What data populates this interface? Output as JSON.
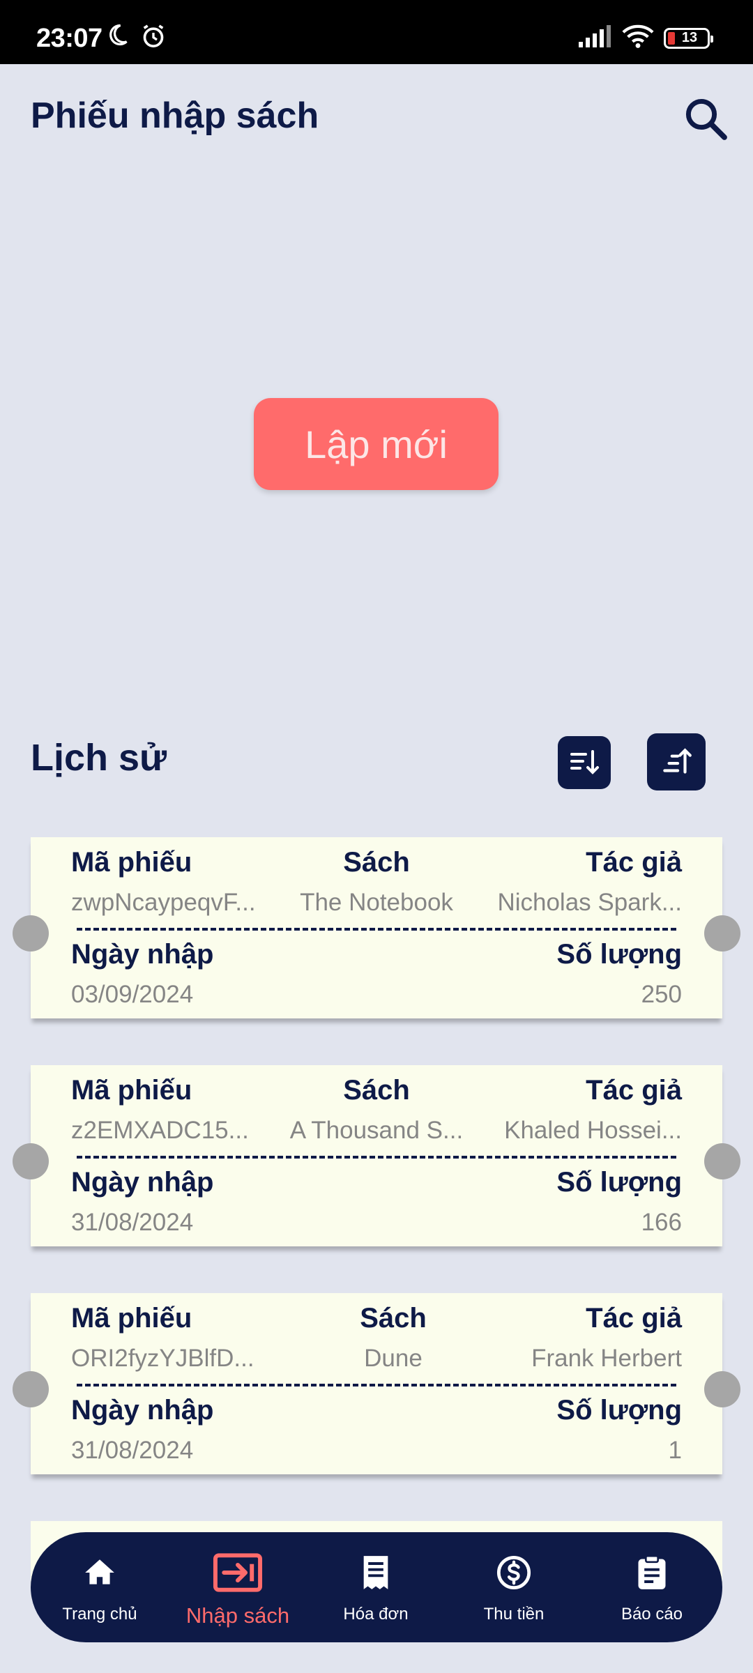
{
  "status_bar": {
    "time": "23:07",
    "battery": "13",
    "icons": [
      "moon-icon",
      "alarm-icon",
      "signal-icon",
      "wifi-icon",
      "battery-icon"
    ]
  },
  "header": {
    "title": "Phiếu nhập sách",
    "search_icon": "search-icon"
  },
  "main": {
    "new_button_label": "Lập mới",
    "history_title": "Lịch sử",
    "sort_desc_icon": "sort-descending-icon",
    "sort_asc_icon": "sort-ascending-icon"
  },
  "labels": {
    "receipt_code": "Mã phiếu",
    "book": "Sách",
    "author": "Tác giả",
    "import_date": "Ngày nhập",
    "quantity": "Số lượng"
  },
  "receipts": [
    {
      "code": "zwpNcaypeqvF...",
      "book": "The Notebook",
      "author": "Nicholas Spark...",
      "date": "03/09/2024",
      "quantity": "250"
    },
    {
      "code": "z2EMXADC15...",
      "book": "A Thousand S...",
      "author": "Khaled Hossei...",
      "date": "31/08/2024",
      "quantity": "166"
    },
    {
      "code": "ORI2fyzYJBlfD...",
      "book": "Dune",
      "author": "Frank Herbert",
      "date": "31/08/2024",
      "quantity": "1"
    }
  ],
  "bottom_nav": {
    "items": [
      {
        "label": "Trang chủ",
        "icon": "home-icon"
      },
      {
        "label": "Nhập sách",
        "icon": "import-icon"
      },
      {
        "label": "Hóa đơn",
        "icon": "receipt-icon"
      },
      {
        "label": "Thu tiền",
        "icon": "dollar-icon"
      },
      {
        "label": "Báo cáo",
        "icon": "clipboard-icon"
      }
    ],
    "active_index": 1
  },
  "colors": {
    "background": "#E1E4EE",
    "navy": "#0E1A47",
    "accent": "#FF6B6B",
    "card": "#FBFDEC",
    "muted_text": "#858585"
  }
}
